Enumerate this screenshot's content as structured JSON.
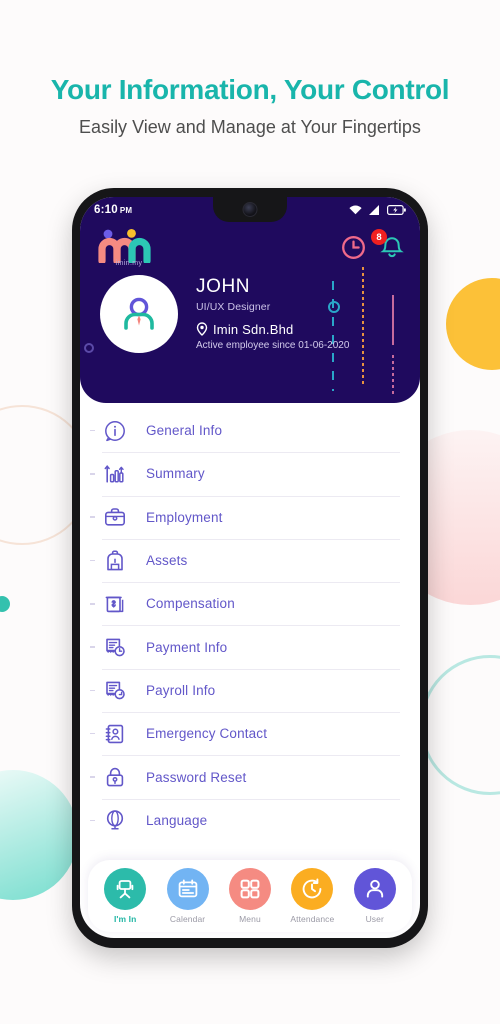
{
  "page": {
    "headline": "Your Information, Your Control",
    "subheadline": "Easily View and Manage at Your Fingertips",
    "accent_teal": "#19b5ab",
    "accent_purple": "#1f0a5e",
    "background": "#fdfbfb"
  },
  "status_bar": {
    "time": "6:10",
    "ampm": "PM",
    "icons": [
      "wifi-icon",
      "cellular-signal-icon",
      "battery-charging-icon"
    ]
  },
  "app_header": {
    "logo_text": "imin.my",
    "logo_mark": "mn-logo-icon",
    "actions": [
      {
        "name": "clock-icon",
        "label": ""
      },
      {
        "name": "notification-bell-icon",
        "label": "",
        "badge": "8"
      }
    ],
    "notification_count": "8"
  },
  "profile": {
    "avatar": "user-avatar-icon",
    "name": "JOHN",
    "role": "UI/UX Designer",
    "company": "Imin Sdn.Bhd",
    "location_icon": "location-pin-icon",
    "since": "Active employee since 01-06-2020"
  },
  "menu": {
    "items": [
      {
        "label": "General Info",
        "icon": "info-circle-icon"
      },
      {
        "label": "Summary",
        "icon": "bar-chart-icon"
      },
      {
        "label": "Employment",
        "icon": "briefcase-icon"
      },
      {
        "label": "Assets",
        "icon": "backpack-icon"
      },
      {
        "label": "Compensation",
        "icon": "money-note-icon"
      },
      {
        "label": "Payment Info",
        "icon": "document-clock-icon"
      },
      {
        "label": "Payroll Info",
        "icon": "document-refresh-icon"
      },
      {
        "label": "Emergency Contact",
        "icon": "contact-book-icon"
      },
      {
        "label": "Password Reset",
        "icon": "lock-key-icon"
      },
      {
        "label": "Language",
        "icon": "globe-icon"
      }
    ]
  },
  "bottom_nav": {
    "items": [
      {
        "label": "I'm In",
        "icon": "office-chair-icon",
        "color": "#2cbbaa",
        "active": true
      },
      {
        "label": "Calendar",
        "icon": "calendar-icon",
        "color": "#72b4f3",
        "active": false
      },
      {
        "label": "Menu",
        "icon": "grid-squares-icon",
        "color": "#f58b82",
        "active": false
      },
      {
        "label": "Attendance",
        "icon": "clock-check-icon",
        "color": "#fbad21",
        "active": false
      },
      {
        "label": "User",
        "icon": "person-icon",
        "color": "#6155d8",
        "active": false
      }
    ]
  }
}
